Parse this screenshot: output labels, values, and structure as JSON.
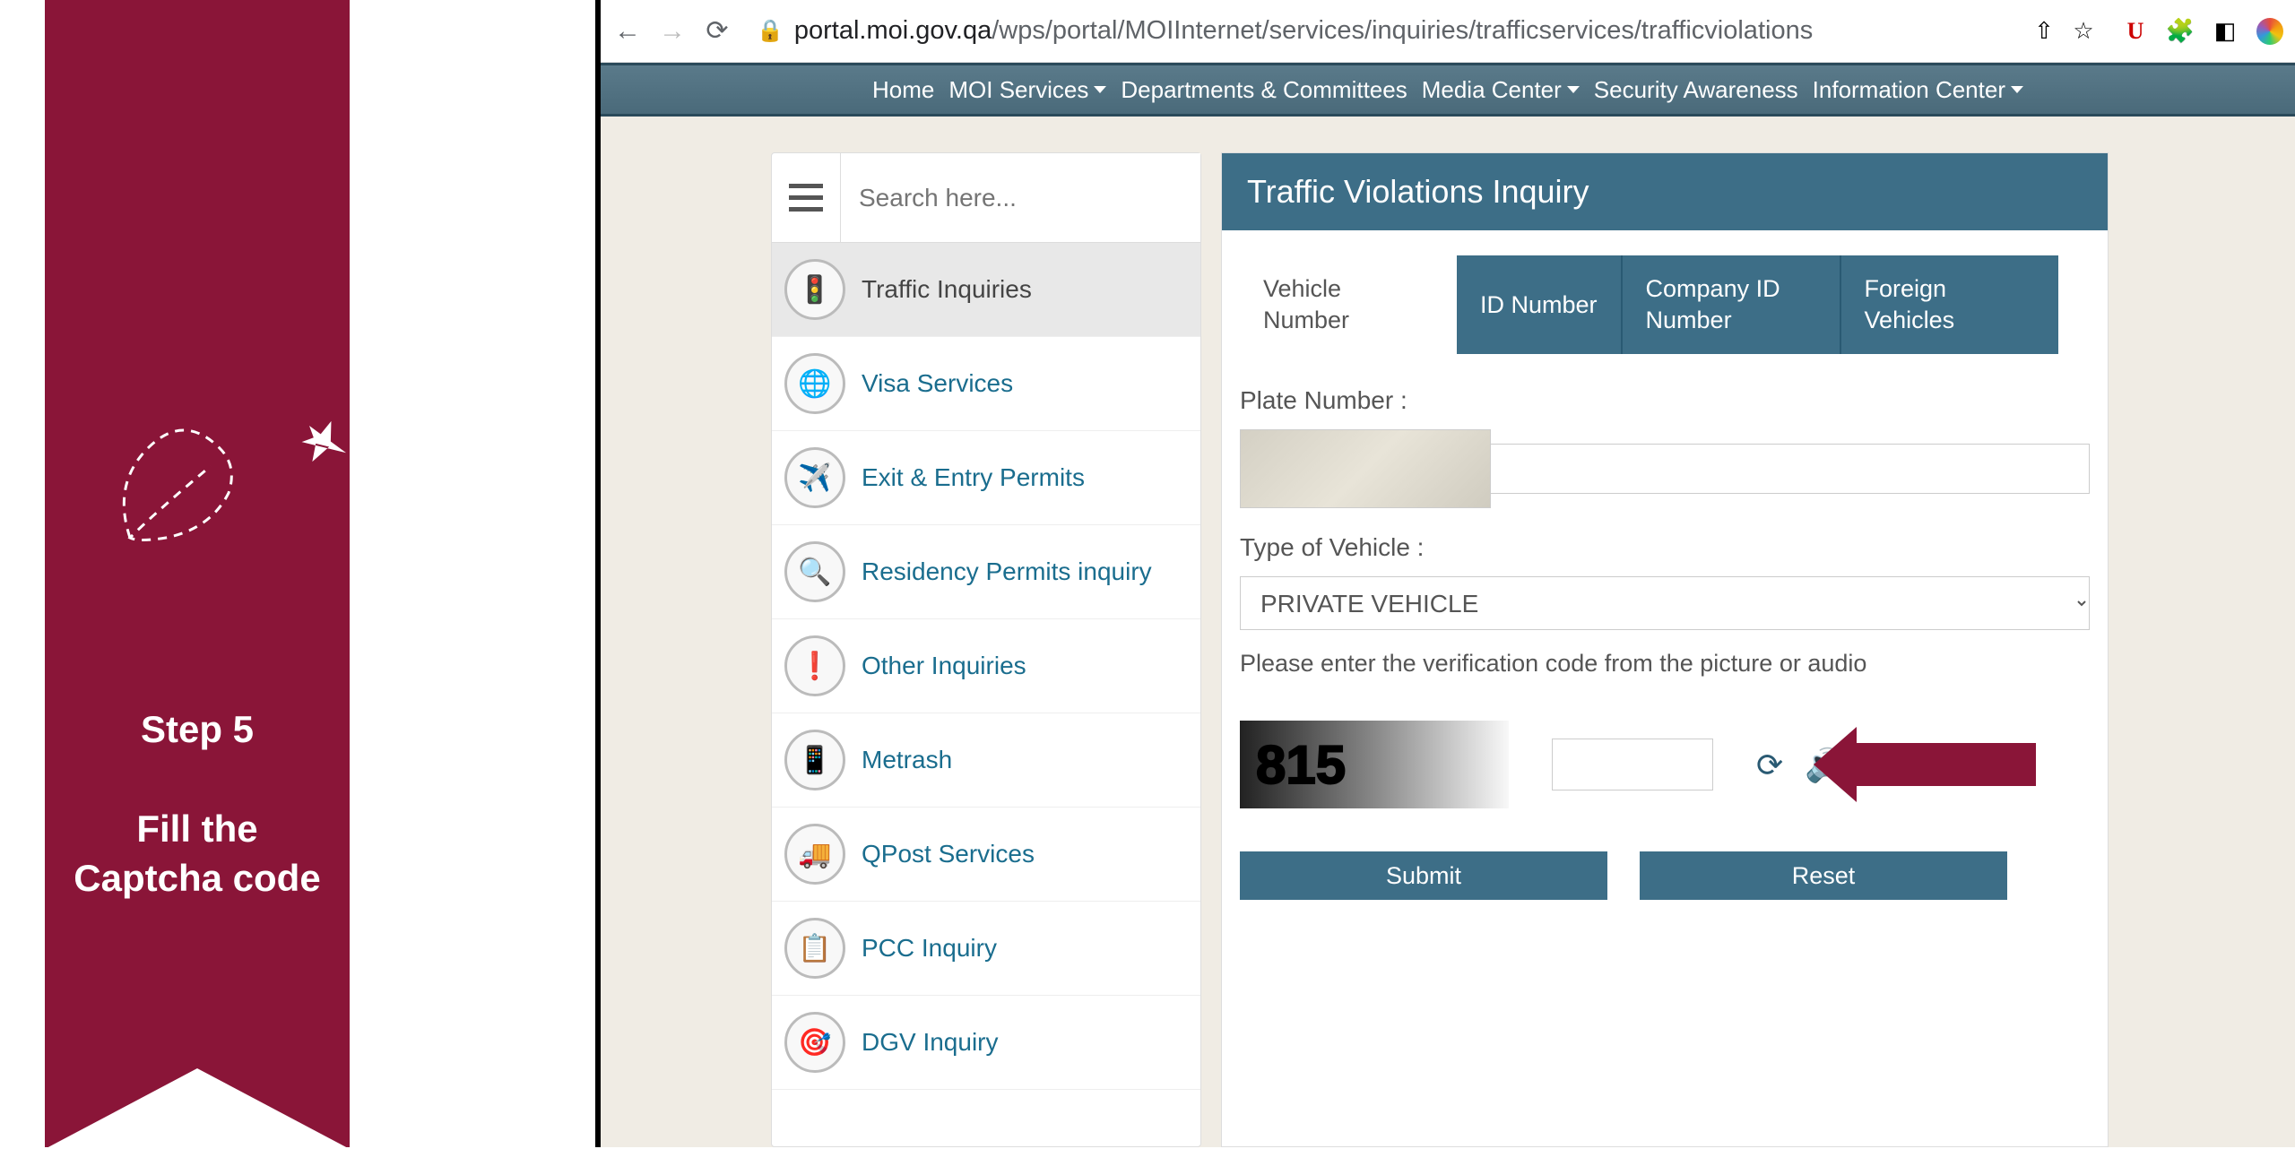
{
  "banner": {
    "step": "Step 5",
    "description": "Fill the Captcha code"
  },
  "browser": {
    "url_domain": "portal.moi.gov.qa",
    "url_path": "/wps/portal/MOIInternet/services/inquiries/trafficservices/trafficviolations",
    "extensions": {
      "u": "U"
    }
  },
  "navbar": {
    "items": [
      {
        "label": "Home",
        "dropdown": false
      },
      {
        "label": "MOI Services",
        "dropdown": true
      },
      {
        "label": "Departments & Committees",
        "dropdown": false
      },
      {
        "label": "Media Center",
        "dropdown": true
      },
      {
        "label": "Security Awareness",
        "dropdown": false
      },
      {
        "label": "Information Center",
        "dropdown": true
      }
    ]
  },
  "sidebar": {
    "search_placeholder": "Search here...",
    "items": [
      {
        "label": "Traffic Inquiries",
        "icon": "🚦",
        "active": true
      },
      {
        "label": "Visa Services",
        "icon": "🌐",
        "active": false
      },
      {
        "label": "Exit & Entry Permits",
        "icon": "✈️",
        "active": false
      },
      {
        "label": "Residency Permits inquiry",
        "icon": "🔍",
        "active": false
      },
      {
        "label": "Other Inquiries",
        "icon": "❗",
        "active": false
      },
      {
        "label": "Metrash",
        "icon": "📱",
        "active": false
      },
      {
        "label": "QPost Services",
        "icon": "🚚",
        "active": false
      },
      {
        "label": "PCC Inquiry",
        "icon": "📋",
        "active": false
      },
      {
        "label": "DGV Inquiry",
        "icon": "🎯",
        "active": false
      }
    ]
  },
  "main": {
    "title": "Traffic Violations Inquiry",
    "tabs": [
      {
        "label": "Vehicle Number",
        "active": true
      },
      {
        "label": "ID Number",
        "active": false
      },
      {
        "label": "Company ID Number",
        "active": false
      },
      {
        "label": "Foreign Vehicles",
        "active": false
      }
    ],
    "fields": {
      "plate_label": "Plate Number :",
      "vehicle_type_label": "Type of Vehicle :",
      "vehicle_type_value": "PRIVATE VEHICLE",
      "captcha_label": "Please enter the verification code from the picture or audio",
      "captcha_value": "815"
    },
    "buttons": {
      "submit": "Submit",
      "reset": "Reset"
    }
  }
}
